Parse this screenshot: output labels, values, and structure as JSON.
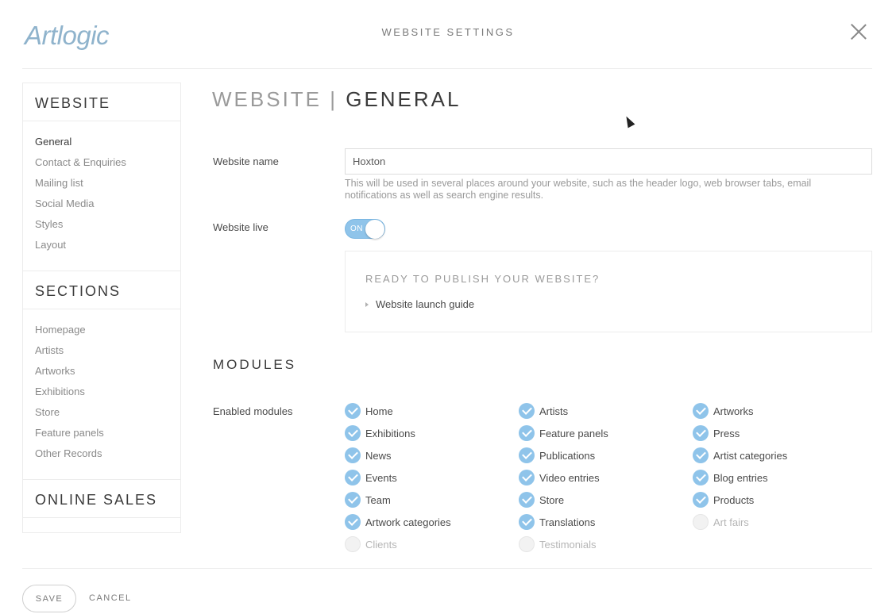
{
  "app": {
    "logo_text": "Artlogic",
    "modal_title": "WEBSITE SETTINGS"
  },
  "sidebar": {
    "website_heading": "WEBSITE",
    "website_items": [
      {
        "label": "General",
        "active": true
      },
      {
        "label": "Contact & Enquiries"
      },
      {
        "label": "Mailing list"
      },
      {
        "label": "Social Media"
      },
      {
        "label": "Styles"
      },
      {
        "label": "Layout"
      }
    ],
    "sections_heading": "SECTIONS",
    "section_items": [
      {
        "label": "Homepage"
      },
      {
        "label": "Artists"
      },
      {
        "label": "Artworks"
      },
      {
        "label": "Exhibitions"
      },
      {
        "label": "Store"
      },
      {
        "label": "Feature panels"
      },
      {
        "label": "Other Records"
      }
    ],
    "online_sales_heading": "ONLINE SALES"
  },
  "main": {
    "title_prefix": "WEBSITE | ",
    "title_accent": "GENERAL",
    "website_name_label": "Website name",
    "website_name_value": "Hoxton",
    "website_name_help": "This will be used in several places around your website, such as the header logo, web browser tabs, email notifications as well as search engine results.",
    "website_live_label": "Website live",
    "website_live_toggle_label": "ON",
    "website_live_on": true,
    "publish_title": "READY TO PUBLISH YOUR WEBSITE?",
    "publish_link": "Website launch guide",
    "modules_heading": "MODULES",
    "enabled_modules_label": "Enabled modules",
    "modules": [
      {
        "label": "Home",
        "checked": true
      },
      {
        "label": "Artists",
        "checked": true
      },
      {
        "label": "Artworks",
        "checked": true
      },
      {
        "label": "Exhibitions",
        "checked": true
      },
      {
        "label": "Feature panels",
        "checked": true
      },
      {
        "label": "Press",
        "checked": true
      },
      {
        "label": "News",
        "checked": true
      },
      {
        "label": "Publications",
        "checked": true
      },
      {
        "label": "Artist categories",
        "checked": true
      },
      {
        "label": "Events",
        "checked": true
      },
      {
        "label": "Video entries",
        "checked": true
      },
      {
        "label": "Blog entries",
        "checked": true
      },
      {
        "label": "Team",
        "checked": true
      },
      {
        "label": "Store",
        "checked": true
      },
      {
        "label": "Products",
        "checked": true
      },
      {
        "label": "Artwork categories",
        "checked": true
      },
      {
        "label": "Translations",
        "checked": true
      },
      {
        "label": "Art fairs",
        "checked": false
      },
      {
        "label": "Clients",
        "checked": false
      },
      {
        "label": "Testimonials",
        "checked": false
      }
    ]
  },
  "footer": {
    "save_label": "SAVE",
    "cancel_label": "CANCEL"
  },
  "colors": {
    "accent": "#8fc4ea",
    "logo": "#8fb3cc"
  }
}
